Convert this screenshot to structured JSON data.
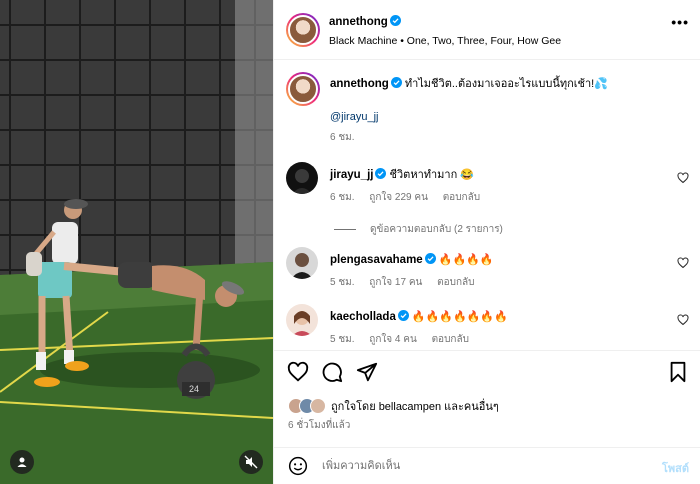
{
  "post": {
    "author": "annethong",
    "music": "Black Machine • One, Two, Three, Four, How Gee",
    "more": "•••"
  },
  "caption": {
    "author": "annethong",
    "text": "ทำไมชีวิต..ต้องมาเจออะไรแบบนี้ทุกเช้า!💦",
    "mention": "@jirayu_jj",
    "time": "6 ชม."
  },
  "comments": [
    {
      "author": "jirayu_jj",
      "text": "ชีวิตหาทำมาก 😂",
      "time": "6 ชม.",
      "likes": "ถูกใจ 229 คน",
      "reply": "ตอบกลับ"
    },
    {
      "author": "plengasavahame",
      "text": "🔥🔥🔥🔥",
      "time": "5 ชม.",
      "likes": "ถูกใจ 17 คน",
      "reply": "ตอบกลับ"
    },
    {
      "author": "kaechollada",
      "text": "🔥🔥🔥🔥🔥🔥🔥",
      "time": "5 ชม.",
      "likes": "ถูกใจ 4 คน",
      "reply": "ตอบกลับ"
    }
  ],
  "view_replies": "ดูข้อความตอบกลับ (2 รายการ)",
  "likes_summary": "ถูกใจโดย bellacampen และคนอื่นๆ",
  "time_ago": "6 ชั่วโมงที่แล้ว",
  "add_comment": {
    "placeholder": "เพิ่มความคิดเห็น",
    "post_label": "โพสต์"
  },
  "kettlebell_label": "24",
  "icons": [
    "user-icon",
    "mute-icon",
    "verified-icon",
    "more-icon",
    "heart-icon",
    "comment-icon",
    "share-icon",
    "bookmark-icon",
    "emoji-icon"
  ],
  "colors": {
    "verified": "#0095f6",
    "mention": "#00376b",
    "secondary_text": "#737373",
    "post_button_disabled": "#b2dffc",
    "floor_green": "#3a6a2a"
  }
}
